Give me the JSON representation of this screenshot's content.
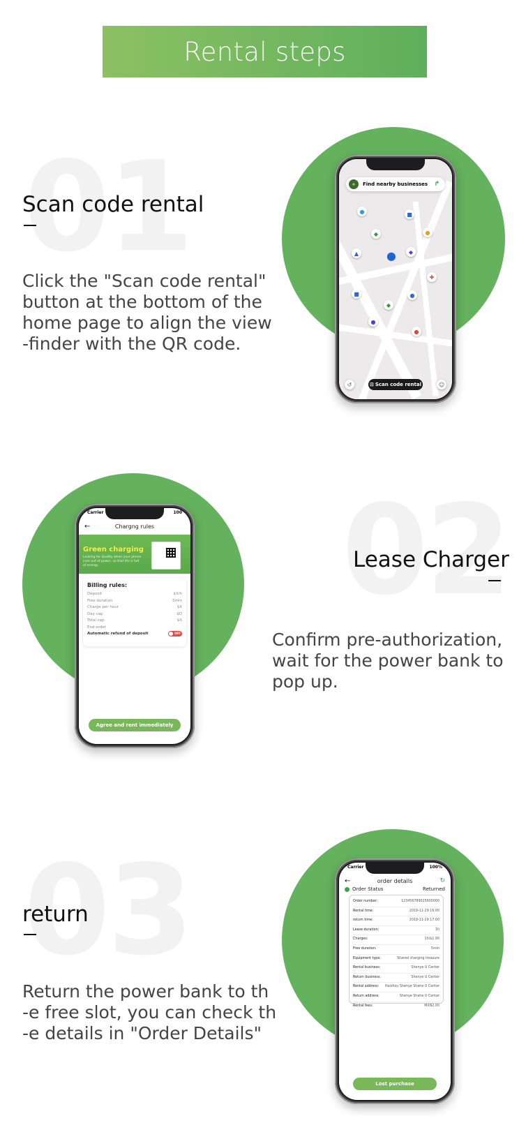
{
  "banner": {
    "title": "Rental steps"
  },
  "steps": [
    {
      "number": "01",
      "title": "Scan code rental",
      "description": "Click the \"Scan code rental\"\nbutton at the bottom of the\nhome page to align the view\n-finder with the QR code."
    },
    {
      "number": "02",
      "title": "Lease Charger",
      "description": "Confirm pre-authorization,\nwait for the power bank to\npop up."
    },
    {
      "number": "03",
      "title": "return",
      "description": "Return the power bank to th\n-e free slot, you can check th\n-e details in \"Order Details\""
    }
  ],
  "phone1": {
    "search_placeholder": "Find nearby businesses",
    "scan_button": "Scan code rental"
  },
  "phone2": {
    "carrier": "Carrier",
    "battery": "100",
    "title": "Chargng rules",
    "banner_title": "Green charging",
    "banner_sub": "Looking for Quality when your phone runs out of power, so that life is full of energy.",
    "billing_title": "Billing rules:",
    "rules": [
      {
        "label": "Deposit",
        "value": "$X/h"
      },
      {
        "label": "Free duration",
        "value": "5min"
      },
      {
        "label": "Charge per hour",
        "value": "$X"
      },
      {
        "label": "Day cap",
        "value": "$D"
      },
      {
        "label": "Total cap",
        "value": "$X"
      },
      {
        "label": "End order",
        "value": ""
      }
    ],
    "auto_refund": "Automatic refund of deposit",
    "toggle": "OFF",
    "agree_button": "Agree and rent immediately"
  },
  "phone3": {
    "carrier": "Carrier",
    "battery": "100%",
    "title": "order details",
    "status_label": "Order Status",
    "status_value": "Returned",
    "rows": [
      {
        "label": "Order number:",
        "value": "123456789025600000"
      },
      {
        "label": "Rental time:",
        "value": "2019-11-29 16:00"
      },
      {
        "label": "return time:",
        "value": "2019-11-29 17:00"
      },
      {
        "label": "Lease duration:",
        "value": "1h"
      },
      {
        "label": "Charges:",
        "value": "1h/$1.00"
      },
      {
        "label": "Free duration:",
        "value": "5min"
      },
      {
        "label": "Equipment type:",
        "value": "Shared charging treasure"
      },
      {
        "label": "Rental business:",
        "value": "Shenye U Center"
      },
      {
        "label": "Return business:",
        "value": "Shenye U Center"
      },
      {
        "label": "Rental address:",
        "value": "Haizhou Shenye Shahe U Center"
      },
      {
        "label": "Return address:",
        "value": "Shenye Shahe U Center"
      },
      {
        "label": "Rental fees:",
        "value": "MXN2.00"
      }
    ],
    "lost_button": "Lost purchase"
  },
  "colors": {
    "brand_green": "#64b25d",
    "banner_start": "#8cc163",
    "banner_end": "#5eaf5c"
  }
}
